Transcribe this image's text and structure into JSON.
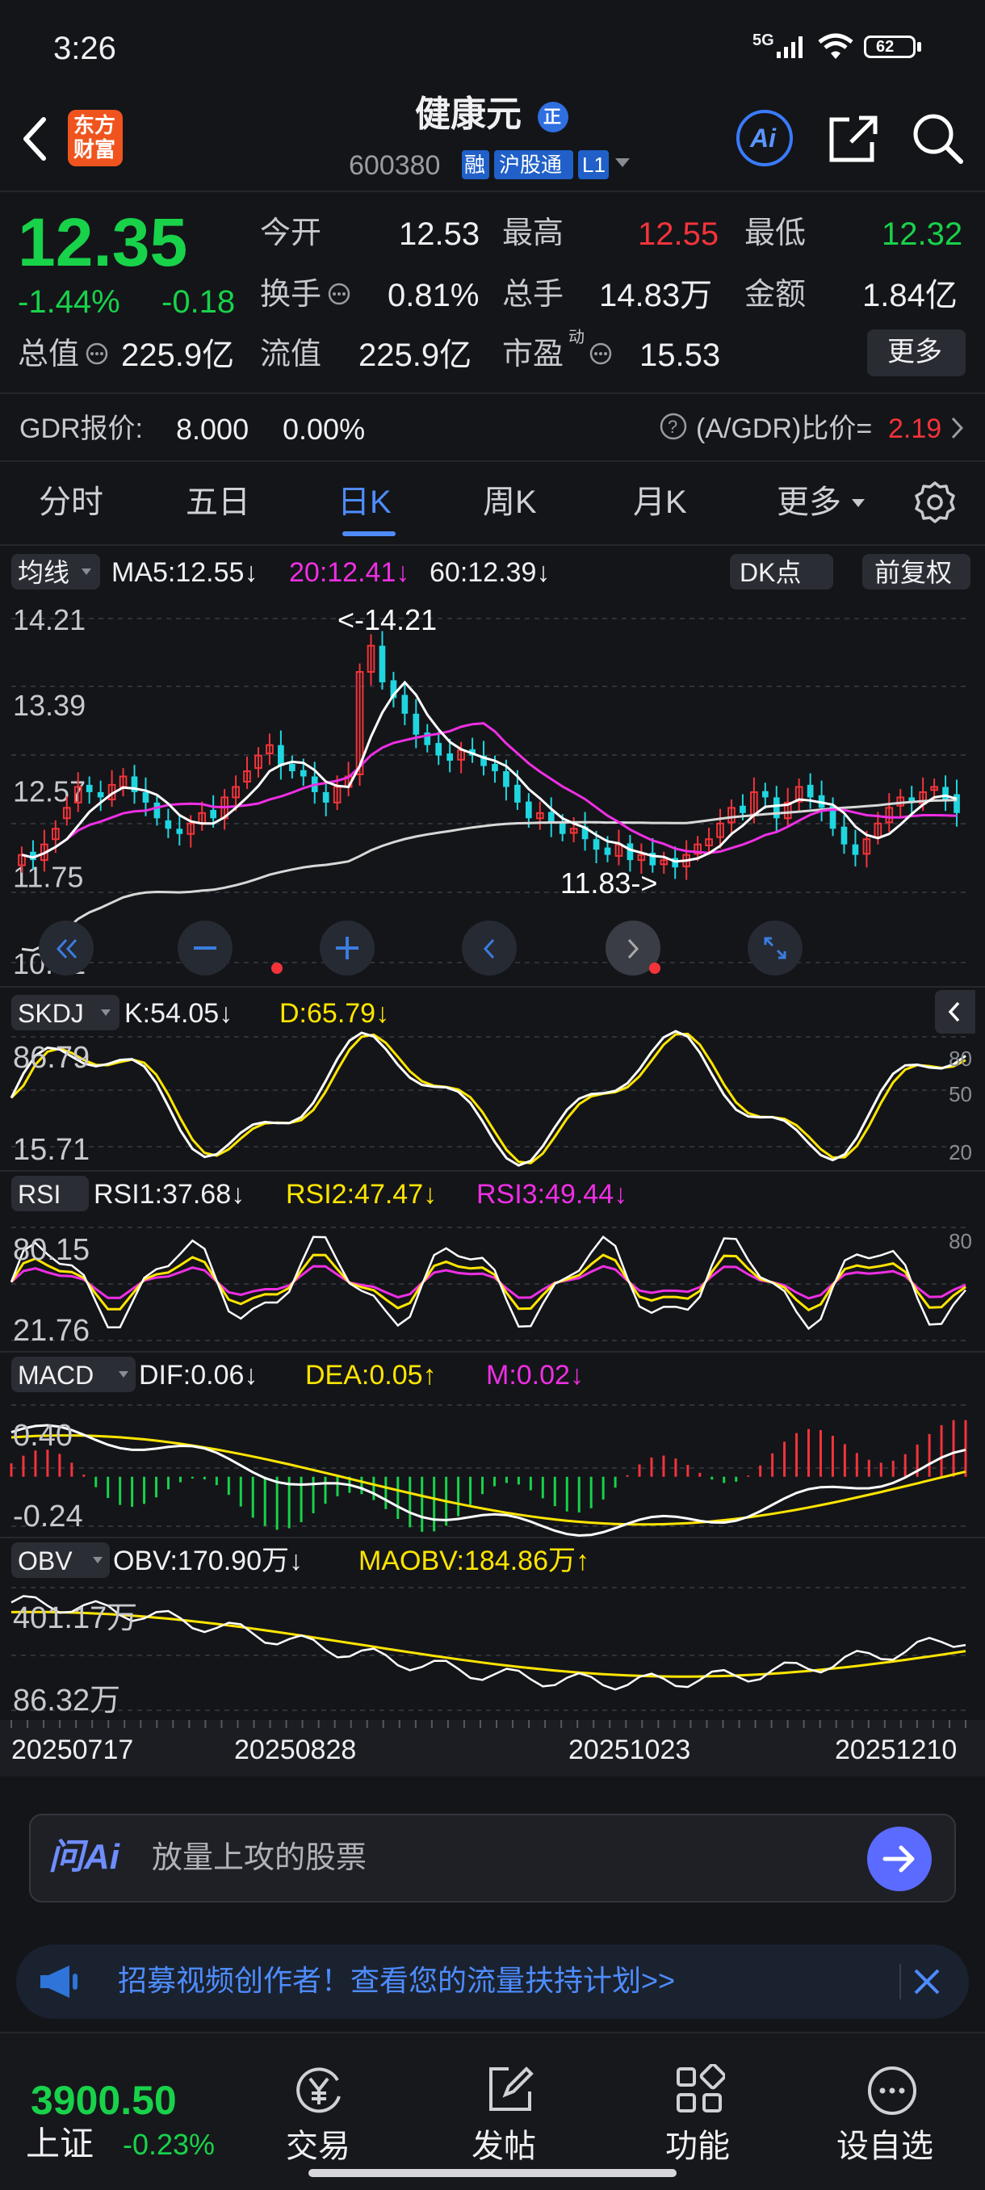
{
  "status_bar": {
    "time": "3:26",
    "network": "5G",
    "battery": "62"
  },
  "header": {
    "brand_line1": "东方",
    "brand_line2": "财富",
    "stock_name": "健康元",
    "badge": "正",
    "code": "600380",
    "tag_rong": "融",
    "tag_hgt": "沪股通",
    "tag_l1": "L1",
    "ai_label": "Ai"
  },
  "quote": {
    "price": "12.35",
    "change_pct": "-1.44%",
    "change": "-0.18",
    "open_label": "今开",
    "open": "12.53",
    "high_label": "最高",
    "high": "12.55",
    "low_label": "最低",
    "low": "12.32",
    "turnover_label": "换手",
    "turnover": "0.81%",
    "volume_label": "总手",
    "volume": "14.83万",
    "amount_label": "金额",
    "amount": "1.84亿",
    "mktcap_label": "总值",
    "mktcap": "225.9亿",
    "float_label": "流值",
    "float_cap": "225.9亿",
    "pe_label": "市盈",
    "pe_sup": "动",
    "pe": "15.53",
    "more_button": "更多"
  },
  "gdr": {
    "label": "GDR报价:",
    "price": "8.000",
    "pct": "0.00%",
    "ratio_label": "(A/GDR)比价=",
    "ratio": "2.19"
  },
  "tabs": [
    {
      "label": "分时",
      "active": false
    },
    {
      "label": "五日",
      "active": false
    },
    {
      "label": "日K",
      "active": true
    },
    {
      "label": "周K",
      "active": false
    },
    {
      "label": "月K",
      "active": false
    },
    {
      "label": "更多",
      "active": false
    }
  ],
  "ma_legend": {
    "selector": "均线",
    "ma5": "MA5:12.55↓",
    "ma20": "20:12.41↓",
    "ma60": "60:12.39↓",
    "dk_button": "DK点",
    "adjust_button": "前复权"
  },
  "chart_data": [
    {
      "type": "candlestick",
      "name": "日K",
      "y_ticks": [
        "14.21",
        "13.39",
        "12.57",
        "11.75",
        "10.92"
      ],
      "ylim": [
        10.92,
        14.21
      ],
      "annotations": [
        "<-14.21",
        "11.83->"
      ],
      "series": [
        {
          "name": "MA5",
          "color": "#ffffff"
        },
        {
          "name": "MA20",
          "color": "#ee2fe3"
        },
        {
          "name": "MA60",
          "color": "#d8d8d8"
        }
      ],
      "legend_values": {
        "MA5": 12.55,
        "MA20": 12.41,
        "MA60": 12.39
      },
      "approx_close": [
        11.95,
        11.9,
        12.05,
        12.2,
        12.4,
        12.6,
        12.55,
        12.5,
        12.62,
        12.7,
        12.55,
        12.45,
        12.3,
        12.2,
        12.15,
        12.25,
        12.35,
        12.3,
        12.5,
        12.6,
        12.75,
        12.9,
        13.0,
        12.8,
        12.75,
        12.7,
        12.55,
        12.45,
        12.6,
        12.7,
        13.7,
        13.95,
        13.6,
        13.45,
        13.3,
        13.1,
        13.0,
        12.9,
        12.85,
        12.95,
        12.9,
        12.8,
        12.75,
        12.6,
        12.45,
        12.3,
        12.35,
        12.25,
        12.15,
        12.2,
        12.1,
        12.0,
        11.95,
        12.05,
        11.9,
        11.95,
        11.85,
        11.9,
        11.83,
        11.95,
        12.05,
        12.1,
        12.25,
        12.4,
        12.35,
        12.55,
        12.5,
        12.3,
        12.45,
        12.6,
        12.5,
        12.4,
        12.2,
        12.05,
        11.95,
        12.1,
        12.25,
        12.4,
        12.5,
        12.45,
        12.55,
        12.6,
        12.48,
        12.35
      ],
      "approx_open": [
        11.85,
        11.98,
        11.9,
        12.1,
        12.3,
        12.45,
        12.62,
        12.55,
        12.48,
        12.6,
        12.7,
        12.55,
        12.45,
        12.28,
        12.2,
        12.15,
        12.25,
        12.38,
        12.3,
        12.5,
        12.65,
        12.78,
        12.92,
        13.0,
        12.82,
        12.76,
        12.7,
        12.55,
        12.45,
        12.6,
        12.72,
        13.7,
        13.95,
        13.62,
        13.48,
        13.3,
        13.12,
        13.02,
        12.92,
        12.86,
        12.96,
        12.9,
        12.82,
        12.75,
        12.62,
        12.46,
        12.3,
        12.36,
        12.26,
        12.16,
        12.22,
        12.1,
        12.02,
        11.94,
        12.06,
        11.9,
        11.97,
        11.86,
        11.92,
        11.84,
        11.96,
        12.04,
        12.12,
        12.26,
        12.42,
        12.34,
        12.56,
        12.5,
        12.3,
        12.46,
        12.62,
        12.52,
        12.42,
        12.22,
        12.05,
        11.96,
        12.12,
        12.26,
        12.42,
        12.5,
        12.44,
        12.57,
        12.6,
        12.53
      ]
    },
    {
      "type": "line",
      "name": "SKDJ",
      "legend": [
        "K:54.05↓",
        "D:65.79↓"
      ],
      "y_ticks": [
        "86.79",
        "15.71"
      ],
      "right_ticks": [
        "80",
        "50",
        "20"
      ],
      "ylim": [
        15.71,
        86.79
      ],
      "series": [
        {
          "name": "K",
          "color": "#ffffff",
          "last": 54.05
        },
        {
          "name": "D",
          "color": "#ffe500",
          "last": 65.79
        }
      ]
    },
    {
      "type": "line",
      "name": "RSI",
      "legend": [
        "RSI1:37.68↓",
        "RSI2:47.47↓",
        "RSI3:49.44↓"
      ],
      "y_ticks": [
        "80.15",
        "21.76"
      ],
      "right_ticks": [
        "80"
      ],
      "ylim": [
        21.76,
        80.15
      ],
      "series": [
        {
          "name": "RSI1",
          "color": "#ffffff",
          "last": 37.68
        },
        {
          "name": "RSI2",
          "color": "#ffe500",
          "last": 47.47
        },
        {
          "name": "RSI3",
          "color": "#ee2fe3",
          "last": 49.44
        }
      ]
    },
    {
      "type": "bar",
      "name": "MACD",
      "legend": [
        "DIF:0.06↓",
        "DEA:0.05↑",
        "M:0.02↓"
      ],
      "y_ticks": [
        "0.40",
        "-0.24"
      ],
      "ylim": [
        -0.24,
        0.4
      ],
      "series": [
        {
          "name": "DIF",
          "color": "#ffffff",
          "last": 0.06
        },
        {
          "name": "DEA",
          "color": "#ffe500",
          "last": 0.05
        },
        {
          "name": "M",
          "color": "#ee2fe3",
          "last": 0.02
        }
      ]
    },
    {
      "type": "line",
      "name": "OBV",
      "legend": [
        "OBV:170.90万↓",
        "MAOBV:184.86万↑"
      ],
      "y_ticks": [
        "401.17万",
        "86.32万"
      ],
      "series": [
        {
          "name": "OBV",
          "color": "#ffffff",
          "last": 170.9
        },
        {
          "name": "MAOBV",
          "color": "#ffe500",
          "last": 184.86
        }
      ]
    }
  ],
  "x_dates": [
    "20250717",
    "20250828",
    "20251023",
    "20251210"
  ],
  "ai_search": {
    "logo": "问Ai",
    "placeholder": "放量上攻的股票"
  },
  "banner": {
    "text": "招募视频创作者！查看您的流量扶持计划>>"
  },
  "bottom_bar": {
    "index_value": "3900.50",
    "index_name": "上证",
    "index_change": "-0.23%",
    "items": [
      {
        "label": "交易",
        "icon": "yen-icon"
      },
      {
        "label": "发帖",
        "icon": "edit-icon"
      },
      {
        "label": "功能",
        "icon": "grid-icon"
      },
      {
        "label": "设自选",
        "icon": "more-icon"
      }
    ]
  }
}
